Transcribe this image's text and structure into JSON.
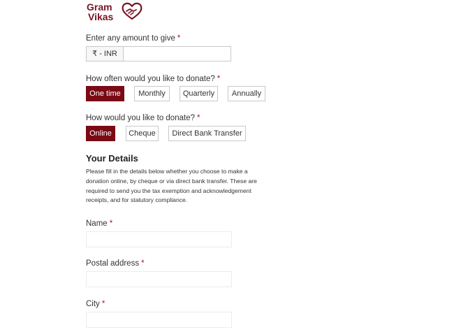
{
  "logo": {
    "line1": "Gram",
    "line2": "Vikas",
    "color": "#7a1424"
  },
  "amount": {
    "label": "Enter any amount to give",
    "required_mark": "*",
    "prefix": "₹ - INR",
    "value": "",
    "placeholder": ""
  },
  "frequency": {
    "label": "How often would you like to donate?",
    "required_mark": "*",
    "options": [
      "One time",
      "Monthly",
      "Quarterly",
      "Annually"
    ],
    "selected": "One time"
  },
  "method": {
    "label": "How would you like to donate?",
    "required_mark": "*",
    "options": [
      "Online",
      "Cheque",
      "Direct Bank Transfer"
    ],
    "selected": "Online"
  },
  "details": {
    "title": "Your Details",
    "description": "Please fill in the details below whether you choose to make a donation online, by cheque or via direct bank transfer. These are required to send you the tax exemption and acknowledgement receipts, and for statutory compliance."
  },
  "fields": {
    "name_label": "Name",
    "address_label": "Postal address",
    "city_label": "City",
    "required_mark": "*"
  },
  "colors": {
    "accent": "#7a0a14",
    "required": "#b3102a",
    "border": "#c9c9c9"
  },
  "icons": {
    "logo_mark": "handshake-heart-icon"
  }
}
